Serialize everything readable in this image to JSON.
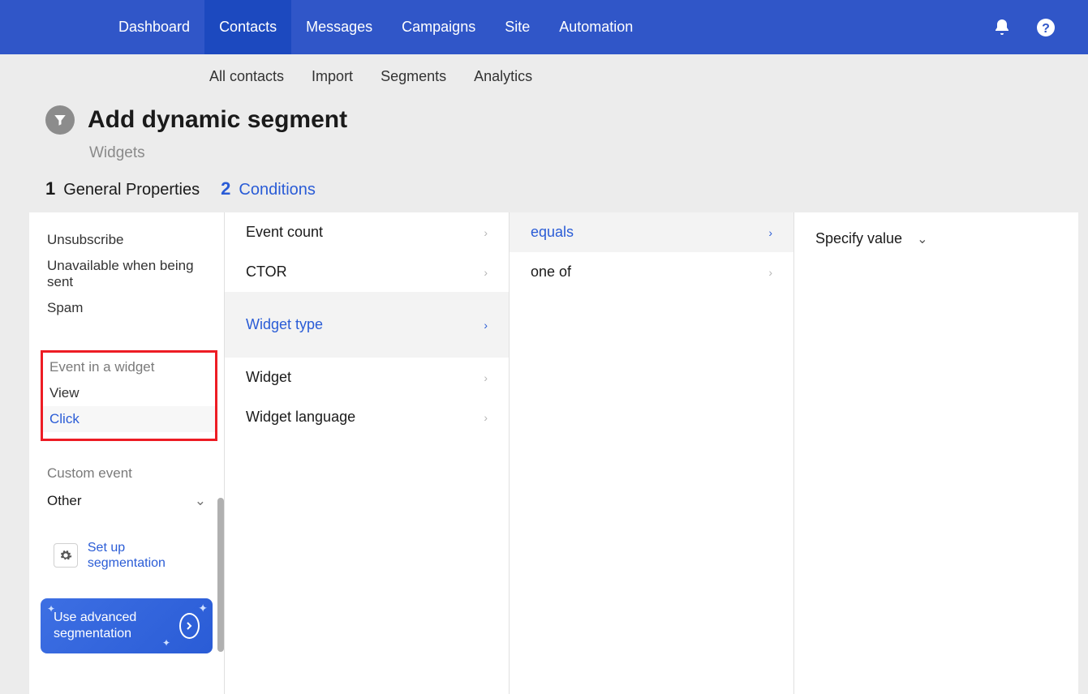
{
  "topnav": {
    "items": [
      "Dashboard",
      "Contacts",
      "Messages",
      "Campaigns",
      "Site",
      "Automation"
    ],
    "activeIndex": 1
  },
  "subnav": {
    "items": [
      "All contacts",
      "Import",
      "Segments",
      "Analytics"
    ]
  },
  "page": {
    "title": "Add dynamic segment",
    "subtitle": "Widgets"
  },
  "tabs": [
    {
      "num": "1",
      "label": "General Properties"
    },
    {
      "num": "2",
      "label": "Conditions"
    }
  ],
  "activeTab": 1,
  "leftPanel": {
    "items_top": [
      "Unsubscribe",
      "Unavailable when being sent",
      "Spam"
    ],
    "groupA": {
      "label": "Event in a widget",
      "items": [
        "View",
        "Click"
      ],
      "selectedIndex": 1
    },
    "groupB": {
      "label": "Custom event"
    },
    "dropdown": {
      "label": "Other"
    },
    "setup_link": "Set up segmentation",
    "adv_button": "Use advanced segmentation"
  },
  "col2": {
    "top": [
      "Event count",
      "CTOR"
    ],
    "selected": "Widget type",
    "bottom": [
      "Widget",
      "Widget language"
    ]
  },
  "col3": {
    "items": [
      "equals",
      "one of"
    ],
    "selectedIndex": 0
  },
  "col4": {
    "label": "Specify value"
  }
}
